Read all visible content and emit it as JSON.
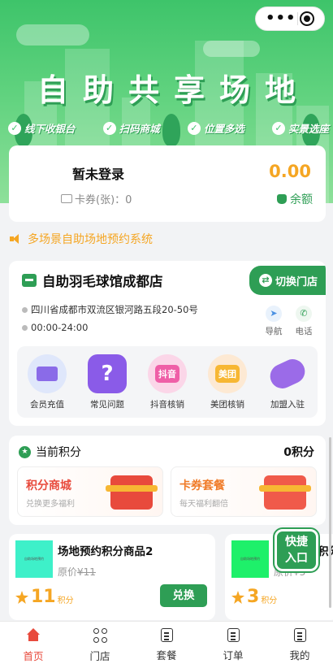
{
  "banner": {
    "title": "自助共享场地",
    "features": [
      "线下收银台",
      "扫码商城",
      "位置多选",
      "实景选座"
    ]
  },
  "login": {
    "status": "暂未登录",
    "coupon_label": "卡券(张)：0",
    "balance": "0.00",
    "balance_label": "余额"
  },
  "notice": "多场景自助场地预约系统",
  "store": {
    "name": "自助羽毛球馆成都店",
    "switch_label": "切换门店",
    "address": "四川省成都市双流区银河路五段20-50号",
    "hours": "00:00-24:00",
    "nav_label": "导航",
    "phone_label": "电话",
    "services": [
      {
        "label": "会员充值",
        "icon": "store-icon",
        "color": "#dfe7fb"
      },
      {
        "label": "常见问题",
        "icon": "question-icon",
        "color": "#8a5be8",
        "glyph": "?"
      },
      {
        "label": "抖音核销",
        "icon": "douyin-icon",
        "color": "#fbd6e8",
        "glyph": "抖音"
      },
      {
        "label": "美团核销",
        "icon": "meituan-icon",
        "color": "#fde9d3",
        "glyph": "美团"
      },
      {
        "label": "加盟入驻",
        "icon": "handshake-icon",
        "color": "#9b6be8"
      }
    ]
  },
  "points": {
    "title": "当前积分",
    "value": "0积分",
    "mall_title": "积分商城",
    "mall_sub": "兑换更多福利",
    "package_title": "卡券套餐",
    "package_sub": "每天福利翻倍"
  },
  "products": [
    {
      "thumb_text": "自助场地预约",
      "name": "场地预约积分商品2",
      "orig_prefix": "原价",
      "orig_price": "¥11",
      "points": "11",
      "unit": "积分",
      "button": "兑换"
    },
    {
      "thumb_text": "自助场地预约",
      "name": "场地预约积分商品",
      "orig_prefix": "原价",
      "orig_price": "¥3",
      "points": "3",
      "unit": "积分"
    }
  ],
  "quick_entry": [
    "快捷",
    "入口"
  ],
  "tabbar": [
    {
      "label": "首页",
      "icon": "home-icon",
      "active": true
    },
    {
      "label": "门店",
      "icon": "store-grid-icon"
    },
    {
      "label": "套餐",
      "icon": "package-icon"
    },
    {
      "label": "订单",
      "icon": "order-icon"
    },
    {
      "label": "我的",
      "icon": "profile-icon"
    }
  ],
  "colors": {
    "primary": "#2e9e55",
    "accent": "#f5a623",
    "active_tab": "#e84a3c"
  }
}
